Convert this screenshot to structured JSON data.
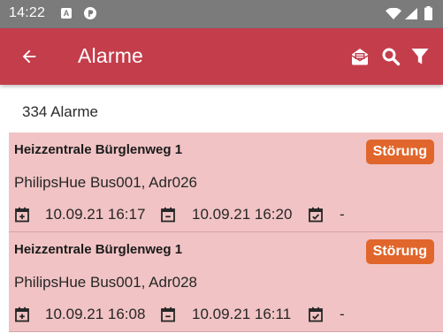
{
  "status_bar": {
    "time": "14:22",
    "a_badge": "A"
  },
  "app_bar": {
    "title": "Alarme",
    "color": "#c43d4b",
    "icons": [
      "arrow-back-icon",
      "mail-open-icon",
      "search-icon",
      "filter-icon"
    ]
  },
  "alarm_count": "334 Alarme",
  "alarms": [
    {
      "title": "Heizzentrale Bürglenweg 1",
      "status": "Störung",
      "source": "PhilipsHue Bus001, Adr026",
      "start": "10.09.21 16:17",
      "end": "10.09.21 16:20",
      "acknowledged": "-"
    },
    {
      "title": "Heizzentrale Bürglenweg 1",
      "status": "Störung",
      "source": "PhilipsHue Bus001, Adr028",
      "start": "10.09.21 16:08",
      "end": "10.09.21 16:11",
      "acknowledged": "-"
    }
  ],
  "colors": {
    "card_background": "#f1c3c4",
    "badge": "#e0662b"
  }
}
